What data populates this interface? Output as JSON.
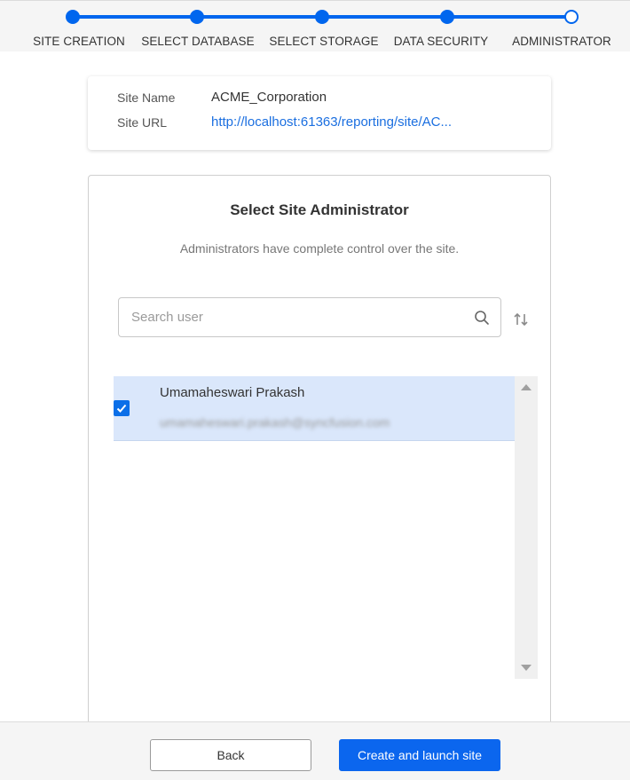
{
  "stepper": {
    "steps": [
      {
        "label": "SITE CREATION",
        "state": "completed"
      },
      {
        "label": "SELECT DATABASE",
        "state": "completed"
      },
      {
        "label": "SELECT STORAGE",
        "state": "completed"
      },
      {
        "label": "DATA SECURITY",
        "state": "completed"
      },
      {
        "label": "ADMINISTRATOR",
        "state": "current"
      }
    ]
  },
  "site_info": {
    "name_label": "Site Name",
    "name_value": "ACME_Corporation",
    "url_label": "Site URL",
    "url_value": "http://localhost:61363/reporting/site/AC..."
  },
  "admin": {
    "title": "Select Site Administrator",
    "subtitle": "Administrators have complete control over the site.",
    "search_placeholder": "Search user",
    "search_value": "",
    "users": [
      {
        "name": "Umamaheswari Prakash",
        "email": "umamaheswari.prakash@syncfusion.com",
        "selected": true
      }
    ]
  },
  "footer": {
    "back_label": "Back",
    "primary_label": "Create and launch site"
  },
  "colors": {
    "accent": "#0066ee",
    "selected_row": "#dae7fb",
    "link": "#1b6fe0"
  },
  "icons": {
    "search": "search-icon",
    "sort": "sort-icon",
    "check": "check-icon"
  }
}
